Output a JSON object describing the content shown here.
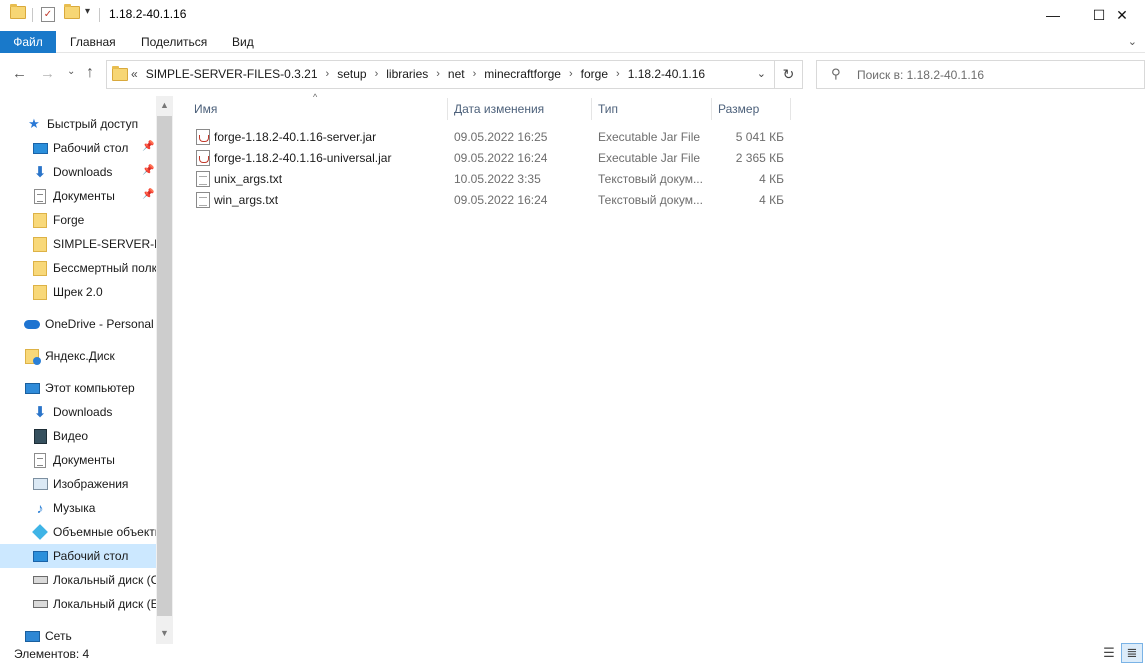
{
  "window": {
    "title": "1.18.2-40.1.16",
    "controls": {
      "minimize": "—",
      "maximize": "☐",
      "close": "✕"
    }
  },
  "ribbon": {
    "tabs": [
      "Файл",
      "Главная",
      "Поделиться",
      "Вид"
    ]
  },
  "address": {
    "overflow": "«",
    "crumbs": [
      "SIMPLE-SERVER-FILES-0.3.21",
      "setup",
      "libraries",
      "net",
      "minecraftforge",
      "forge",
      "1.18.2-40.1.16"
    ]
  },
  "search": {
    "placeholder": "Поиск в: 1.18.2-40.1.16"
  },
  "nav": {
    "quick_access": "Быстрый доступ",
    "quick_items": [
      "Рабочий стол",
      "Downloads",
      "Документы",
      "Forge",
      "SIMPLE-SERVER-FIL",
      "Бессмертный полк",
      "Шрек 2.0"
    ],
    "onedrive": "OneDrive - Personal",
    "yadisk": "Яндекс.Диск",
    "this_pc": "Этот компьютер",
    "pc_items": [
      "Downloads",
      "Видео",
      "Документы",
      "Изображения",
      "Музыка",
      "Объемные объекты",
      "Рабочий стол",
      "Локальный диск (C:)",
      "Локальный диск (E:)"
    ],
    "network": "Сеть"
  },
  "columns": {
    "name": "Имя",
    "date": "Дата изменения",
    "type": "Тип",
    "size": "Размер"
  },
  "files": [
    {
      "name": "forge-1.18.2-40.1.16-server.jar",
      "date": "09.05.2022 16:25",
      "type": "Executable Jar File",
      "size": "5 041 КБ",
      "icon": "jar-icon"
    },
    {
      "name": "forge-1.18.2-40.1.16-universal.jar",
      "date": "09.05.2022 16:24",
      "type": "Executable Jar File",
      "size": "2 365 КБ",
      "icon": "jar-icon"
    },
    {
      "name": "unix_args.txt",
      "date": "10.05.2022 3:35",
      "type": "Текстовый докум...",
      "size": "4 КБ",
      "icon": "text-file-icon"
    },
    {
      "name": "win_args.txt",
      "date": "09.05.2022 16:24",
      "type": "Текстовый докум...",
      "size": "4 КБ",
      "icon": "text-file-icon"
    }
  ],
  "status": {
    "count": "Элементов: 4"
  },
  "colors": {
    "accent": "#1979ca",
    "selected": "#cce8ff"
  }
}
